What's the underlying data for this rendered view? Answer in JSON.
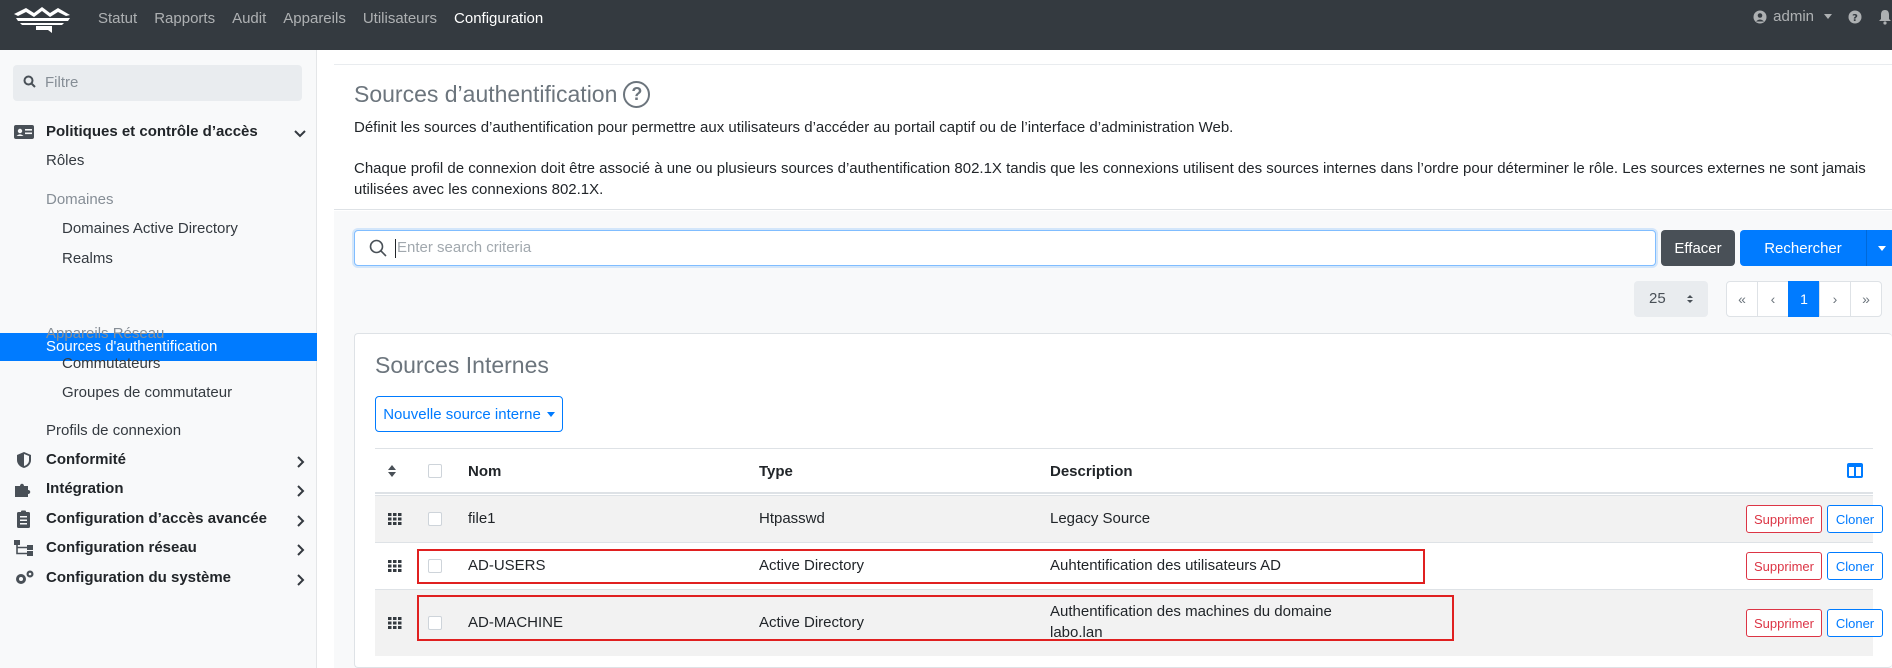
{
  "topbar": {
    "nav": [
      "Statut",
      "Rapports",
      "Audit",
      "Appareils",
      "Utilisateurs",
      "Configuration"
    ],
    "active_nav": "Configuration",
    "user_label": "admin"
  },
  "sidebar": {
    "filter_placeholder": "Filtre",
    "sections": {
      "policies": "Politiques et contrôle d’accès",
      "roles": "Rôles",
      "domains_group": "Domaines",
      "ad_domains": "Domaines Active Directory",
      "realms": "Realms",
      "auth_sources": "Sources d'authentification",
      "network_devices_group": "Appareils Réseau",
      "switches": "Commutateurs",
      "switch_groups": "Groupes de commutateur",
      "connection_profiles": "Profils de connexion",
      "compliance": "Conformité",
      "integration": "Intégration",
      "advanced_access": "Configuration d’accès avancée",
      "network_config": "Configuration réseau",
      "system_config": "Configuration du système"
    }
  },
  "main": {
    "title": "Sources d’authentification",
    "description1": "Définit les sources d’authentification pour permettre aux utilisateurs d’accéder au portail captif ou de l’interface d’administration Web.",
    "description2": "Chaque profil de connexion doit être associé à une ou plusieurs sources d’authentification 802.1X tandis que les connexions utilisent des sources internes dans l’ordre pour déterminer le rôle. Les sources externes ne sont jamais utilisées avec les connexions 802.1X.",
    "search_placeholder": "Enter search criteria",
    "clear_label": "Effacer",
    "search_label": "Rechercher",
    "per_page": "25",
    "pager": [
      "«",
      "‹",
      "1",
      "›",
      "»"
    ],
    "card_title": "Sources Internes",
    "new_source_label": "Nouvelle source interne",
    "columns": [
      "Nom",
      "Type",
      "Description"
    ],
    "rows": [
      {
        "name": "file1",
        "type": "Htpasswd",
        "description": "Legacy Source",
        "desc2": ""
      },
      {
        "name": "AD-USERS",
        "type": "Active Directory",
        "description": "Auhtentification des utilisateurs AD",
        "desc2": ""
      },
      {
        "name": "AD-MACHINE",
        "type": "Active Directory",
        "description": "Authentification des machines du domaine",
        "desc2": "labo.lan"
      }
    ],
    "delete_label": "Supprimer",
    "clone_label": "Cloner"
  },
  "colors": {
    "topbar": "#343a40",
    "accent": "#007bff",
    "danger": "#dc3545",
    "highlight": "#e02020"
  }
}
